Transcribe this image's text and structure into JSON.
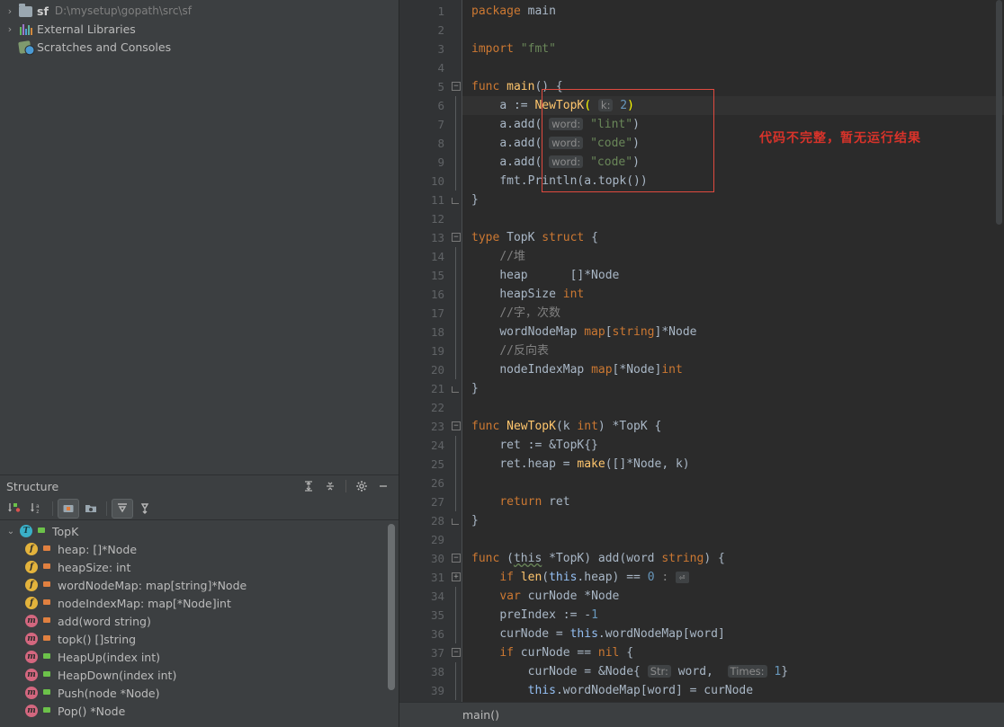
{
  "project": {
    "items": [
      {
        "arrow": "›",
        "icon": "folder-icon",
        "label": "sf",
        "path": "D:\\mysetup\\gopath\\src\\sf",
        "bold": true
      },
      {
        "arrow": "›",
        "icon": "library-icon",
        "label": "External Libraries",
        "path": "",
        "bold": false
      },
      {
        "arrow": "",
        "icon": "scratches-icon",
        "label": "Scratches and Consoles",
        "path": "",
        "bold": false
      }
    ]
  },
  "structure": {
    "title": "Structure",
    "header_buttons": [
      "expand-all-icon",
      "collapse-all-icon",
      "settings-icon",
      "hide-icon"
    ],
    "toolbar_buttons": [
      "sort-by-visibility-icon",
      "sort-alphabetically-icon",
      "show-fields-icon",
      "show-non-public-icon",
      "expand-icon",
      "collapse-icon"
    ],
    "items": [
      {
        "indent": 0,
        "arrow": "⌄",
        "badge": "T",
        "badge_kind": "t",
        "lock": "public",
        "label": "TopK"
      },
      {
        "indent": 1,
        "arrow": "",
        "badge": "f",
        "badge_kind": "f",
        "lock": "private",
        "label": "heap: []*Node"
      },
      {
        "indent": 1,
        "arrow": "",
        "badge": "f",
        "badge_kind": "f",
        "lock": "private",
        "label": "heapSize: int"
      },
      {
        "indent": 1,
        "arrow": "",
        "badge": "f",
        "badge_kind": "f",
        "lock": "private",
        "label": "wordNodeMap: map[string]*Node"
      },
      {
        "indent": 1,
        "arrow": "",
        "badge": "f",
        "badge_kind": "f",
        "lock": "private",
        "label": "nodeIndexMap: map[*Node]int"
      },
      {
        "indent": 1,
        "arrow": "",
        "badge": "m",
        "badge_kind": "m",
        "lock": "private",
        "label": "add(word string)"
      },
      {
        "indent": 1,
        "arrow": "",
        "badge": "m",
        "badge_kind": "m",
        "lock": "private",
        "label": "topk() []string"
      },
      {
        "indent": 1,
        "arrow": "",
        "badge": "m",
        "badge_kind": "m",
        "lock": "public",
        "label": "HeapUp(index int)"
      },
      {
        "indent": 1,
        "arrow": "",
        "badge": "m",
        "badge_kind": "m",
        "lock": "public",
        "label": "HeapDown(index int)"
      },
      {
        "indent": 1,
        "arrow": "",
        "badge": "m",
        "badge_kind": "m",
        "lock": "public",
        "label": "Push(node *Node)"
      },
      {
        "indent": 1,
        "arrow": "",
        "badge": "m",
        "badge_kind": "m",
        "lock": "public",
        "label": "Pop() *Node"
      }
    ]
  },
  "editor": {
    "line_numbers": [
      "1",
      "2",
      "3",
      "4",
      "5",
      "6",
      "7",
      "8",
      "9",
      "10",
      "11",
      "12",
      "13",
      "14",
      "15",
      "16",
      "17",
      "18",
      "19",
      "20",
      "21",
      "22",
      "23",
      "24",
      "25",
      "26",
      "27",
      "28",
      "29",
      "30",
      "31",
      "34",
      "35",
      "36",
      "37",
      "38",
      "39"
    ],
    "annotation": "代码不完整，暂无运行结果",
    "annotation_color": "#d8332a",
    "lines": [
      {
        "n": "1",
        "html": "<span class='kw'>package</span> <span class='pln'>main</span>"
      },
      {
        "n": "2",
        "html": ""
      },
      {
        "n": "3",
        "html": "<span class='kw'>import</span> <span class='str'>\"fmt\"</span>"
      },
      {
        "n": "4",
        "html": ""
      },
      {
        "n": "5",
        "html": "<span class='kw'>func</span> <span class='fn'>main</span><span class='pln'>() {</span>"
      },
      {
        "n": "6",
        "html": "    <span class='pln'>a := </span><span class='fn'>NewTopK</span><span class='paren-hl'>(</span> <span class='hint'>k:</span> <span class='num'>2</span><span class='paren-hl'>)</span>"
      },
      {
        "n": "7",
        "html": "    <span class='pln'>a.add(</span> <span class='hint'>word:</span> <span class='str'>\"lint\"</span><span class='pln'>)</span>"
      },
      {
        "n": "8",
        "html": "    <span class='pln'>a.add(</span> <span class='hint'>word:</span> <span class='str'>\"code\"</span><span class='pln'>)</span>"
      },
      {
        "n": "9",
        "html": "    <span class='pln'>a.add(</span> <span class='hint'>word:</span> <span class='str'>\"code\"</span><span class='pln'>)</span>"
      },
      {
        "n": "10",
        "html": "    <span class='pln'>fmt.Println(a.topk())</span>"
      },
      {
        "n": "11",
        "html": "<span class='pln'>}</span>"
      },
      {
        "n": "12",
        "html": ""
      },
      {
        "n": "13",
        "html": "<span class='kw'>type</span> <span class='pln'>TopK</span> <span class='kw'>struct</span> <span class='pln'>{</span>"
      },
      {
        "n": "14",
        "html": "    <span class='cmt'>//堆</span>"
      },
      {
        "n": "15",
        "html": "    <span class='pln'>heap      []*Node</span>"
      },
      {
        "n": "16",
        "html": "    <span class='pln'>heapSize </span><span class='kw'>int</span>"
      },
      {
        "n": "17",
        "html": "    <span class='cmt'>//字，次数</span>"
      },
      {
        "n": "18",
        "html": "    <span class='pln'>wordNodeMap </span><span class='kw'>map</span><span class='pln'>[</span><span class='kw'>string</span><span class='pln'>]*Node</span>"
      },
      {
        "n": "19",
        "html": "    <span class='cmt'>//反向表</span>"
      },
      {
        "n": "20",
        "html": "    <span class='pln'>nodeIndexMap </span><span class='kw'>map</span><span class='pln'>[*Node]</span><span class='kw'>int</span>"
      },
      {
        "n": "21",
        "html": "<span class='pln'>}</span>"
      },
      {
        "n": "22",
        "html": ""
      },
      {
        "n": "23",
        "html": "<span class='kw'>func</span> <span class='fn'>NewTopK</span><span class='pln'>(k </span><span class='kw'>int</span><span class='pln'>) *TopK {</span>"
      },
      {
        "n": "24",
        "html": "    <span class='pln'>ret := &amp;TopK{}</span>"
      },
      {
        "n": "25",
        "html": "    <span class='pln'>ret.heap = </span><span class='fn'>make</span><span class='pln'>([]*Node, k)</span>"
      },
      {
        "n": "26",
        "html": ""
      },
      {
        "n": "27",
        "html": "    <span class='kw'>return</span> <span class='pln'>ret</span>"
      },
      {
        "n": "28",
        "html": "<span class='pln'>}</span>"
      },
      {
        "n": "29",
        "html": ""
      },
      {
        "n": "30",
        "html": "<span class='kw'>func</span> <span class='pln'>(</span><span class='recv'>this</span> <span class='pln'>*TopK) add(word </span><span class='kw'>string</span><span class='pln'>) {</span>"
      },
      {
        "n": "31",
        "html": "    <span class='kw'>if</span> <span class='fn'>len</span><span class='pln'>(</span><span class='this-kw'>this</span><span class='pln'>.heap) == </span><span class='num'>0</span> <span class='cmt'>:</span> <span class='folded'>⏎</span>"
      },
      {
        "n": "34",
        "html": "    <span class='kw'>var</span> <span class='pln'>curNode *Node</span>"
      },
      {
        "n": "35",
        "html": "    <span class='pln'>preIndex := -</span><span class='num'>1</span>"
      },
      {
        "n": "36",
        "html": "    <span class='pln'>curNode = </span><span class='this-kw'>this</span><span class='pln'>.wordNodeMap[word]</span>"
      },
      {
        "n": "37",
        "html": "    <span class='kw'>if</span> <span class='pln'>curNode == </span><span class='kw'>nil</span> <span class='pln'>{</span>"
      },
      {
        "n": "38",
        "html": "        <span class='pln'>curNode = &amp;Node{</span> <span class='hint'>Str:</span> <span class='pln'>word,</span>  <span class='hint'>Times:</span> <span class='num'>1</span><span class='pln'>}</span>"
      },
      {
        "n": "39",
        "html": "        <span class='this-kw'>this</span><span class='pln'>.wordNodeMap[word] = curNode</span>"
      }
    ]
  },
  "breadcrumb": {
    "text": "main()"
  }
}
